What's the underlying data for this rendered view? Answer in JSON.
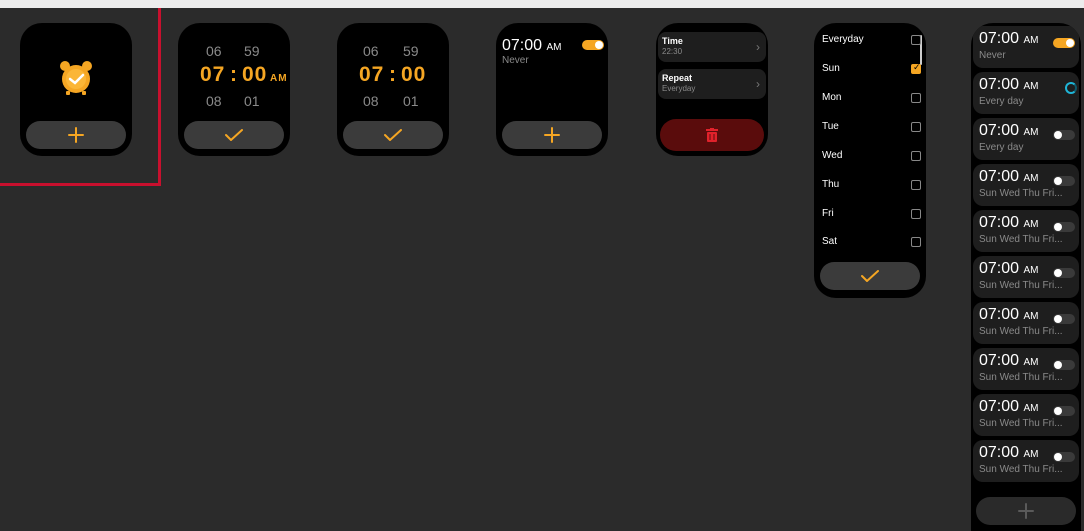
{
  "screen2": {
    "prev_hour": "06",
    "prev_min": "59",
    "hour": "07",
    "sep": ":",
    "min": "00",
    "ampm": "AM",
    "next_hour": "08",
    "next_min": "01"
  },
  "screen3": {
    "prev_hour": "06",
    "prev_min": "59",
    "hour": "07",
    "sep": ":",
    "min": "00",
    "next_hour": "08",
    "next_min": "01"
  },
  "screen4": {
    "time": "07:00",
    "ampm": "AM",
    "repeat": "Never"
  },
  "screen5": {
    "time_label": "Time",
    "time_value": "22:30",
    "repeat_label": "Repeat",
    "repeat_value": "Everyday"
  },
  "screen6": {
    "days": [
      {
        "label": "Everyday",
        "checked": false
      },
      {
        "label": "Sun",
        "checked": true
      },
      {
        "label": "Mon",
        "checked": false
      },
      {
        "label": "Tue",
        "checked": false
      },
      {
        "label": "Wed",
        "checked": false
      },
      {
        "label": "Thu",
        "checked": false
      },
      {
        "label": "Fri",
        "checked": false
      },
      {
        "label": "Sat",
        "checked": false
      }
    ]
  },
  "screen7": {
    "alarms": [
      {
        "time": "07:00",
        "ampm": "AM",
        "repeat": "Never",
        "state": "on"
      },
      {
        "time": "07:00",
        "ampm": "AM",
        "repeat": "Every day",
        "state": "loading"
      },
      {
        "time": "07:00",
        "ampm": "AM",
        "repeat": "Every day",
        "state": "off"
      },
      {
        "time": "07:00",
        "ampm": "AM",
        "repeat": "Sun Wed Thu Fri...",
        "state": "off"
      },
      {
        "time": "07:00",
        "ampm": "AM",
        "repeat": "Sun Wed Thu Fri...",
        "state": "off"
      },
      {
        "time": "07:00",
        "ampm": "AM",
        "repeat": "Sun Wed Thu Fri...",
        "state": "off"
      },
      {
        "time": "07:00",
        "ampm": "AM",
        "repeat": "Sun Wed Thu Fri...",
        "state": "off"
      },
      {
        "time": "07:00",
        "ampm": "AM",
        "repeat": "Sun Wed Thu Fri...",
        "state": "off"
      },
      {
        "time": "07:00",
        "ampm": "AM",
        "repeat": "Sun Wed Thu Fri...",
        "state": "off"
      },
      {
        "time": "07:00",
        "ampm": "AM",
        "repeat": "Sun Wed Thu Fri...",
        "state": "off"
      }
    ]
  },
  "colors": {
    "accent": "#f5a623",
    "background": "#2b2b2b",
    "screen": "#000000",
    "delete": "#5a0c0c",
    "highlight": "#c8102e"
  }
}
